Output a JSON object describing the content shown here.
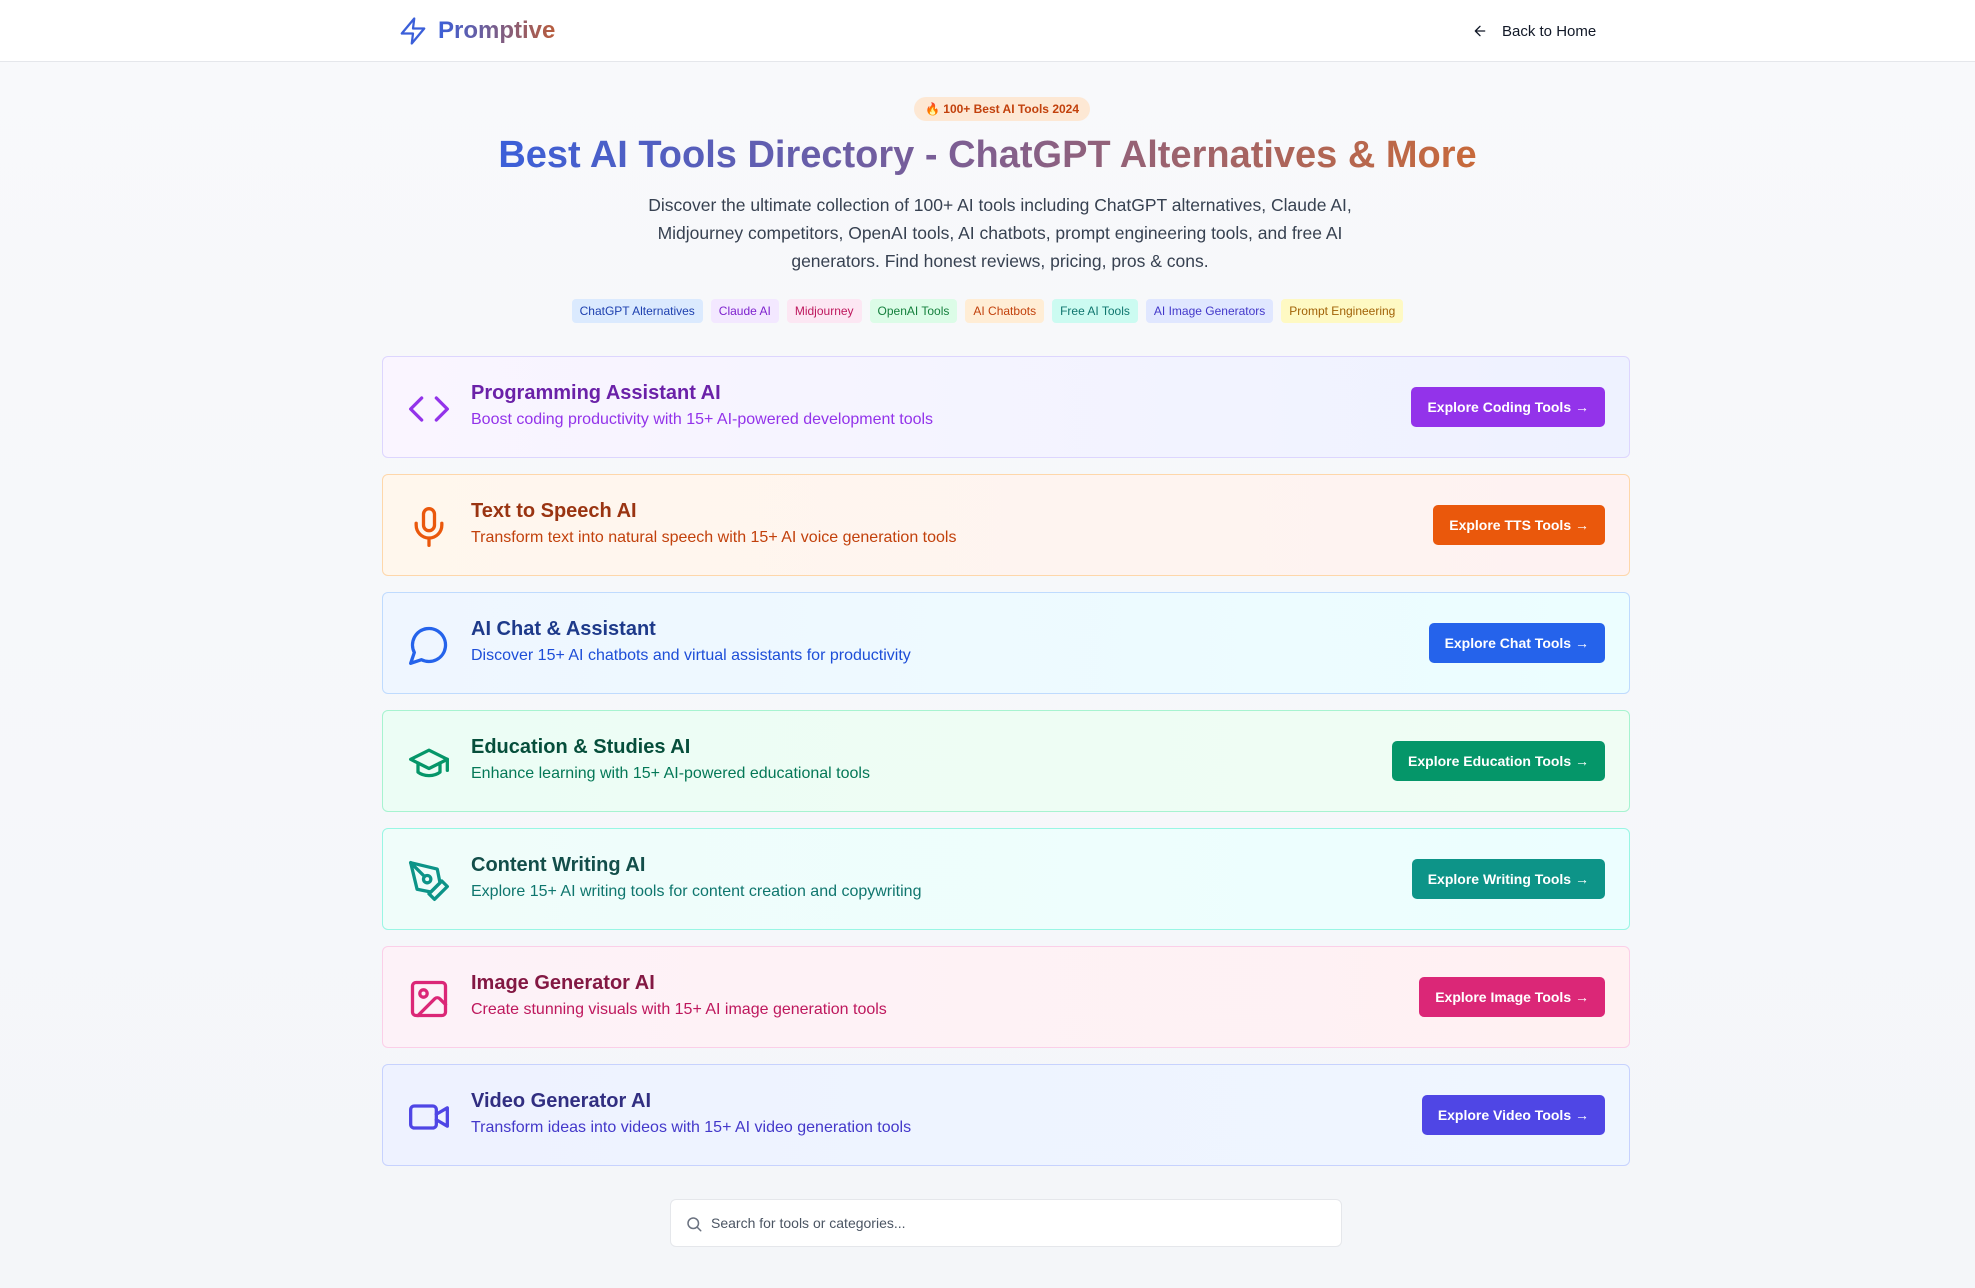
{
  "header": {
    "brand": "Promptive",
    "back_label": "Back to Home"
  },
  "hero": {
    "badge": "🔥 100+ Best AI Tools 2024",
    "title": "Best AI Tools Directory - ChatGPT Alternatives & More",
    "description": "Discover the ultimate collection of 100+ AI tools including ChatGPT alternatives, Claude AI, Midjourney competitors, OpenAI tools, AI chatbots, prompt engineering tools, and free AI generators. Find honest reviews, pricing, pros & cons."
  },
  "tags": [
    {
      "label": "ChatGPT Alternatives",
      "bg": "#dbeafe",
      "color": "#1e40af"
    },
    {
      "label": "Claude AI",
      "bg": "#f3e8ff",
      "color": "#7e22ce"
    },
    {
      "label": "Midjourney",
      "bg": "#fce7f3",
      "color": "#be185d"
    },
    {
      "label": "OpenAI Tools",
      "bg": "#dcfce7",
      "color": "#15803d"
    },
    {
      "label": "AI Chatbots",
      "bg": "#ffedd5",
      "color": "#c2410c"
    },
    {
      "label": "Free AI Tools",
      "bg": "#ccfbf1",
      "color": "#0f766e"
    },
    {
      "label": "AI Image Generators",
      "bg": "#e0e7ff",
      "color": "#4338ca"
    },
    {
      "label": "Prompt Engineering",
      "bg": "#fef9c3",
      "color": "#a16207"
    }
  ],
  "categories": [
    {
      "title": "Programming Assistant AI",
      "description": "Boost coding productivity with 15+ AI-powered development tools",
      "button": "Explore Coding Tools →",
      "icon": "code-icon",
      "accent": "#9333ea",
      "title_color": "#6b21a8",
      "desc_color": "#9333ea",
      "bg_from": "#faf5ff",
      "bg_to": "#eef2ff",
      "border": "#ddd6fe"
    },
    {
      "title": "Text to Speech AI",
      "description": "Transform text into natural speech with 15+ AI voice generation tools",
      "button": "Explore TTS Tools →",
      "icon": "microphone-icon",
      "accent": "#ea580c",
      "title_color": "#9a3412",
      "desc_color": "#c2410c",
      "bg_from": "#fff7ed",
      "bg_to": "#fef2f2",
      "border": "#fed7aa"
    },
    {
      "title": "AI Chat & Assistant",
      "description": "Discover 15+ AI chatbots and virtual assistants for productivity",
      "button": "Explore Chat Tools →",
      "icon": "chat-bubble-icon",
      "accent": "#2563eb",
      "title_color": "#1e3a8a",
      "desc_color": "#1d4ed8",
      "bg_from": "#eff6ff",
      "bg_to": "#ecfeff",
      "border": "#bfdbfe"
    },
    {
      "title": "Education & Studies AI",
      "description": "Enhance learning with 15+ AI-powered educational tools",
      "button": "Explore Education Tools →",
      "icon": "graduation-cap-icon",
      "accent": "#059669",
      "title_color": "#064e3b",
      "desc_color": "#047857",
      "bg_from": "#ecfdf5",
      "bg_to": "#f0fdf4",
      "border": "#a7f3d0"
    },
    {
      "title": "Content Writing AI",
      "description": "Explore 15+ AI writing tools for content creation and copywriting",
      "button": "Explore Writing Tools →",
      "icon": "pen-tool-icon",
      "accent": "#0d9488",
      "title_color": "#134e4a",
      "desc_color": "#0f766e",
      "bg_from": "#f0fdfa",
      "bg_to": "#ecfeff",
      "border": "#99f6e4"
    },
    {
      "title": "Image Generator AI",
      "description": "Create stunning visuals with 15+ AI image generation tools",
      "button": "Explore Image Tools →",
      "icon": "image-icon",
      "accent": "#db2777",
      "title_color": "#831843",
      "desc_color": "#be185d",
      "bg_from": "#fdf2f8",
      "bg_to": "#fff1f2",
      "border": "#fbcfe8"
    },
    {
      "title": "Video Generator AI",
      "description": "Transform ideas into videos with 15+ AI video generation tools",
      "button": "Explore Video Tools →",
      "icon": "video-camera-icon",
      "accent": "#4f46e5",
      "title_color": "#312e81",
      "desc_color": "#4338ca",
      "bg_from": "#eef2ff",
      "bg_to": "#eff6ff",
      "border": "#c7d2fe"
    }
  ],
  "search": {
    "placeholder": "Search for tools or categories..."
  }
}
